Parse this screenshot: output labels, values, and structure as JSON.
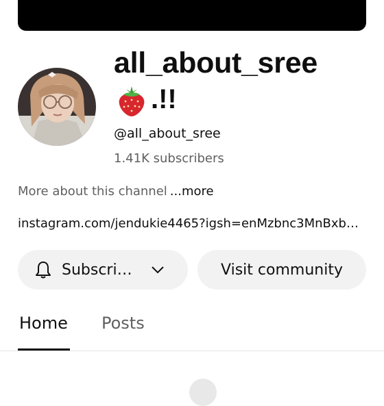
{
  "channel": {
    "name": "all_about_sree",
    "name_suffix": ".!!",
    "handle": "@all_about_sree",
    "subscribers": "1.41K subscribers",
    "about_text": "More about this channel",
    "about_more": "...more",
    "link": "instagram.com/jendukie4465?igsh=enMzbnc3MnBxb…"
  },
  "buttons": {
    "subscribe": "Subscri…",
    "visit_community": "Visit community"
  },
  "tabs": [
    {
      "label": "Home",
      "active": true
    },
    {
      "label": "Posts",
      "active": false
    }
  ],
  "icons": {
    "bell": "bell-icon",
    "chevron": "chevron-down-icon",
    "emoji": "strawberry-emoji"
  },
  "colors": {
    "text_primary": "#0f0f0f",
    "text_secondary": "#606060",
    "button_bg": "#f2f2f2",
    "banner": "#000000"
  }
}
